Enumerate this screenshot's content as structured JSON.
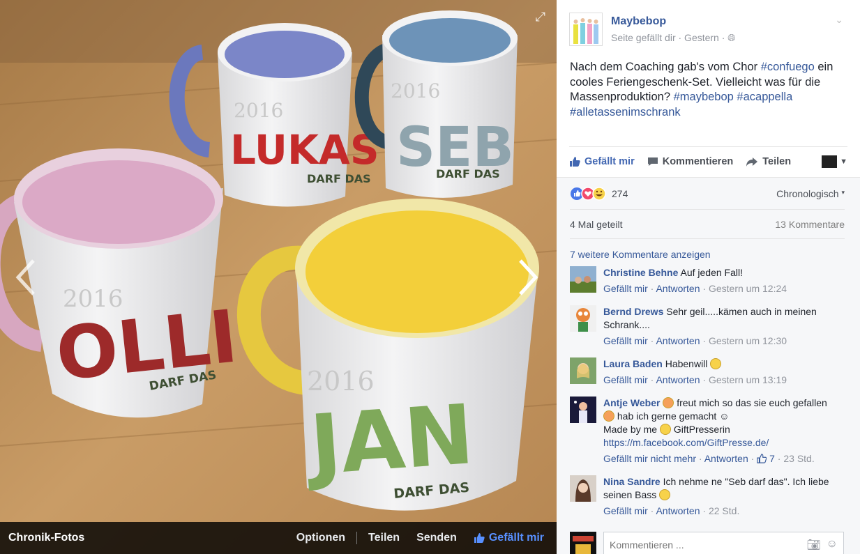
{
  "photo": {
    "bottom_bar": {
      "title": "Chronik-Fotos",
      "options": "Optionen",
      "share": "Teilen",
      "send": "Senden",
      "like": "Gefällt mir"
    },
    "mugs": [
      {
        "name": "LUKAS",
        "year": "2016",
        "tagline": "DARF DAS",
        "inner_color": "#7b86c8"
      },
      {
        "name": "SEB",
        "year": "2016",
        "tagline": "DARF DAS",
        "inner_color": "#6d93b8"
      },
      {
        "name": "OLLI",
        "year": "2016",
        "tagline": "DARF DAS",
        "inner_color": "#dba9c6"
      },
      {
        "name": "JAN",
        "year": "2016",
        "tagline": "DARF DAS",
        "inner_color": "#f3cf3a"
      }
    ],
    "colors": {
      "wood": "#b88a55",
      "lukas": "#c42a2a",
      "seb": "#8fa4ad",
      "olli": "#9d2a2a",
      "jan": "#7fa95a"
    }
  },
  "post": {
    "page_name": "Maybebop",
    "meta": "Seite gefällt dir · Gestern · ",
    "text_before": "Nach dem Coaching gab's vom Chor ",
    "tag1": "#confuego",
    "text_mid": " ein cooles Feriengeschenk-Set. Vielleicht was für die Massenproduktion? ",
    "tag2": "#maybebop",
    "tag3": "#acappella",
    "tag4": "#alletassenimschrank",
    "actions": {
      "like": "Gefällt mir",
      "comment": "Kommentieren",
      "share": "Teilen"
    },
    "reactions_count": "274",
    "order": "Chronologisch",
    "shares": "4 Mal geteilt",
    "comments_count": "13 Kommentare",
    "more_comments": "7 weitere Kommentare anzeigen"
  },
  "comments": [
    {
      "author": "Christine Behne",
      "text": "Auf jeden Fall!",
      "like": "Gefällt mir",
      "reply": "Antworten",
      "time": "Gestern um 12:24"
    },
    {
      "author": "Bernd Drews",
      "text": "Sehr geil.....kämen auch in meinen Schrank....",
      "like": "Gefällt mir",
      "reply": "Antworten",
      "time": "Gestern um 12:30"
    },
    {
      "author": "Laura Baden",
      "text": "Habenwill",
      "like": "Gefällt mir",
      "reply": "Antworten",
      "time": "Gestern um 13:19"
    },
    {
      "author": "Antje Weber",
      "text1": "freut mich so das sie euch gefallen",
      "text2": "hab ich gerne gemacht ☺",
      "text3": "Made by me",
      "text4": "GiftPresserin",
      "link": "https://m.facebook.com/GiftPresse.de/",
      "like": "Gefällt mir nicht mehr",
      "reply": "Antworten",
      "likes": "7",
      "time": "23 Std."
    },
    {
      "author": "Nina Sandre",
      "text": "Ich nehme ne \"Seb darf das\". Ich liebe seinen Bass",
      "like": "Gefällt mir",
      "reply": "Antworten",
      "time": "22 Std."
    }
  ],
  "composer": {
    "placeholder": "Kommentieren ..."
  }
}
